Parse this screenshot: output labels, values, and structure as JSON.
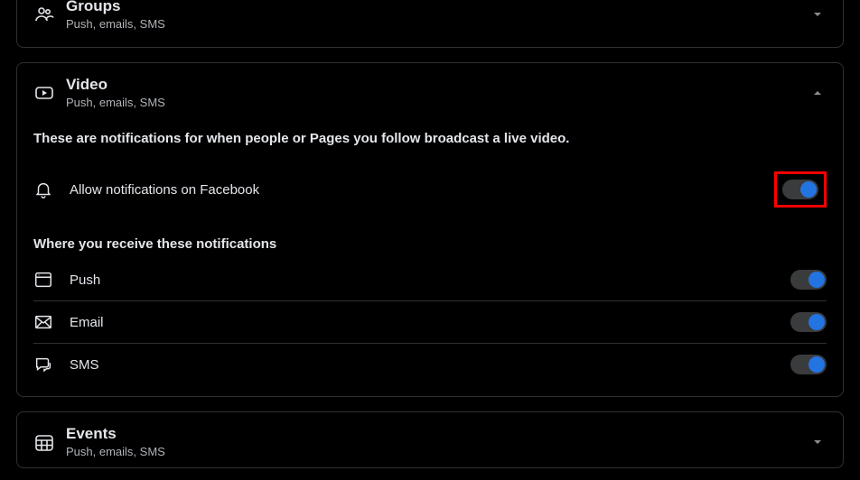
{
  "sections": {
    "groups": {
      "title": "Groups",
      "subtitle": "Push, emails, SMS"
    },
    "video": {
      "title": "Video",
      "subtitle": "Push, emails, SMS",
      "description": "These are notifications for when people or Pages you follow broadcast a live video.",
      "allow_label": "Allow notifications on Facebook",
      "allow_on": true,
      "where_label": "Where you receive these notifications",
      "rows": {
        "push": {
          "label": "Push",
          "on": true
        },
        "email": {
          "label": "Email",
          "on": true
        },
        "sms": {
          "label": "SMS",
          "on": true
        }
      }
    },
    "events": {
      "title": "Events",
      "subtitle": "Push, emails, SMS"
    }
  }
}
